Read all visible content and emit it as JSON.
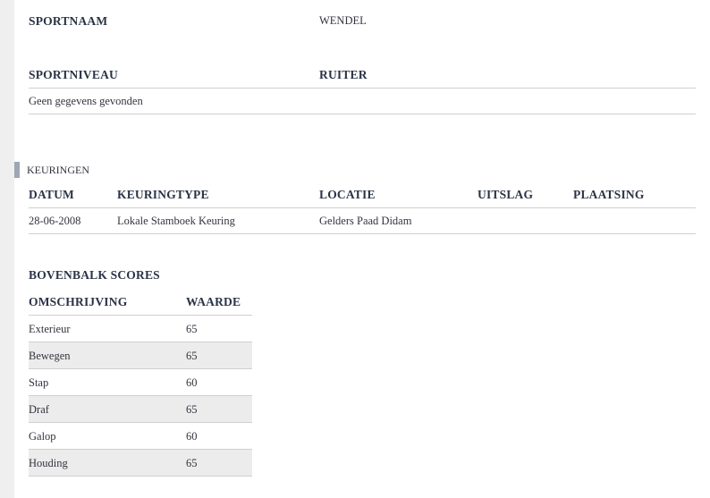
{
  "info": {
    "sportnaam_label": "SPORTNAAM",
    "sportnaam_value": "WENDEL",
    "sportniveau_label": "SPORTNIVEAU",
    "ruiter_label": "RUITER",
    "empty_message": "Geen gegevens gevonden"
  },
  "keuringen": {
    "section_title": "KEURINGEN",
    "headers": [
      "DATUM",
      "KEURINGTYPE",
      "LOCATIE",
      "UITSLAG",
      "PLAATSING"
    ],
    "rows": [
      {
        "datum": "28-06-2008",
        "keuringtype": "Lokale Stamboek Keuring",
        "locatie": "Gelders Paad Didam",
        "uitslag": "",
        "plaatsing": ""
      }
    ]
  },
  "bovenbalk": {
    "title": "BOVENBALK SCORES",
    "headers": [
      "OMSCHRIJVING",
      "WAARDE"
    ],
    "rows": [
      {
        "omschrijving": "Exterieur",
        "waarde": "65"
      },
      {
        "omschrijving": "Bewegen",
        "waarde": "65"
      },
      {
        "omschrijving": "Stap",
        "waarde": "60"
      },
      {
        "omschrijving": "Draf",
        "waarde": "65"
      },
      {
        "omschrijving": "Galop",
        "waarde": "60"
      },
      {
        "omschrijving": "Houding",
        "waarde": "65"
      }
    ]
  },
  "colors": {
    "left_bar": "#efefef",
    "section_marker": "#9ea7b5",
    "alt_row": "#ececec",
    "rule": "#cfcfcf"
  }
}
